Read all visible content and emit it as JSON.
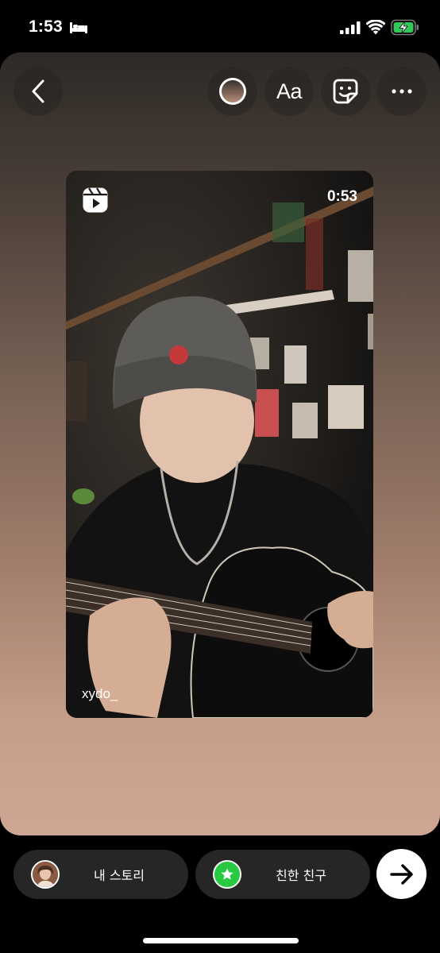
{
  "status_bar": {
    "time": "1:53",
    "focus_icon": "bed-icon",
    "signal_icon": "cellular-signal-icon",
    "wifi_icon": "wifi-icon",
    "battery_icon": "battery-charging-icon",
    "battery_color": "#34c759"
  },
  "toolbar": {
    "back_icon": "chevron-left-icon",
    "color_picker_icon": "color-swatch-icon",
    "text_tool_label": "Aa",
    "sticker_icon": "sticker-icon",
    "more_icon": "more-horizontal-icon"
  },
  "reel": {
    "type_icon": "reels-icon",
    "duration": "0:53",
    "username": "xydo_"
  },
  "share_bar": {
    "your_story_label": "내 스토리",
    "close_friends_label": "친한 친구",
    "close_friends_color": "#28c840",
    "send_icon": "arrow-right-icon"
  }
}
